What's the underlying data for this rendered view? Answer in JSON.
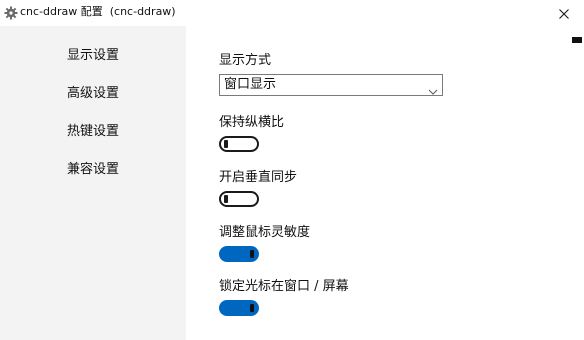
{
  "window": {
    "title": "cnc-ddraw 配置  (cnc-ddraw)",
    "app_icon": "gear-icon",
    "close_icon": "close-icon"
  },
  "sidebar": {
    "items": [
      {
        "label": "显示设置"
      },
      {
        "label": "高级设置"
      },
      {
        "label": "热键设置"
      },
      {
        "label": "兼容设置"
      }
    ]
  },
  "settings": {
    "display_mode": {
      "label": "显示方式",
      "value": "窗口显示"
    },
    "maintain_aspect_ratio": {
      "label": "保持纵横比",
      "enabled": false
    },
    "vsync": {
      "label": "开启垂直同步",
      "enabled": false
    },
    "adjust_mouse_sensitivity": {
      "label": "调整鼠标灵敏度",
      "enabled": true
    },
    "lock_cursor": {
      "label": "锁定光标在窗口 / 屏幕",
      "enabled": true
    }
  },
  "colors": {
    "accent": "#0067c0",
    "sidebar_bg": "#f3f3f3"
  }
}
